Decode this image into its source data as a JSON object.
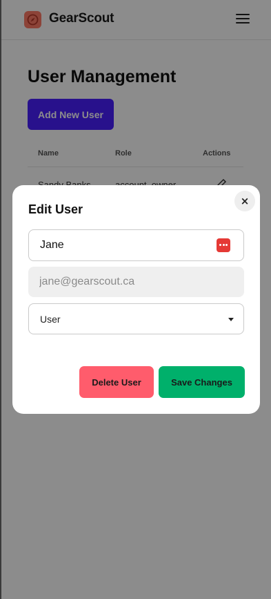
{
  "header": {
    "app_title": "GearScout",
    "logo_icon": "compass-icon",
    "menu_icon": "hamburger-menu-icon"
  },
  "main": {
    "page_title": "User Management",
    "add_user_label": "Add New User",
    "table": {
      "columns": [
        "Name",
        "Role",
        "Actions"
      ],
      "rows": [
        {
          "name": "Sandy Banks",
          "role": "account_owner",
          "action_icon": "edit-pencil-icon"
        }
      ]
    }
  },
  "modal": {
    "title": "Edit User",
    "close_label": "×",
    "name_value": "Jane",
    "email_value": "jane@gearscout.ca",
    "role_value": "User",
    "delete_label": "Delete User",
    "save_label": "Save Changes"
  },
  "colors": {
    "primary": "#4a1fff",
    "danger": "#ff5c6c",
    "success": "#00b06b",
    "logo": "#ff7a66"
  }
}
